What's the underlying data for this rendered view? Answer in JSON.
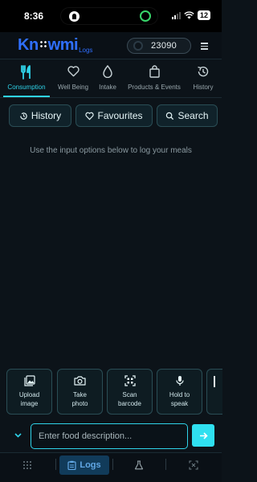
{
  "status_bar": {
    "time": "8:36",
    "battery": "12"
  },
  "header": {
    "logo_main_1": "Kn",
    "logo_main_2": "wmi",
    "logo_sub": "Logs",
    "points": "23090"
  },
  "categories": [
    {
      "label": "Consumption",
      "icon": "utensils-icon",
      "active": true
    },
    {
      "label": "Well Being",
      "icon": "heart-icon",
      "active": false
    },
    {
      "label": "Intake",
      "icon": "drop-icon",
      "active": false
    },
    {
      "label": "Products & Events",
      "icon": "shopping-bag-icon",
      "active": false
    },
    {
      "label": "History",
      "icon": "history-icon",
      "active": false
    }
  ],
  "actions": {
    "history": "History",
    "favourites": "Favourites",
    "search": "Search"
  },
  "empty_message": "Use the input options below to log your meals",
  "input_options": [
    {
      "line1": "Upload",
      "line2": "image",
      "icon": "image-icon"
    },
    {
      "line1": "Take",
      "line2": "photo",
      "icon": "camera-icon"
    },
    {
      "line1": "Scan",
      "line2": "barcode",
      "icon": "barcode-scan-icon"
    },
    {
      "line1": "Hold to",
      "line2": "speak",
      "icon": "microphone-icon"
    }
  ],
  "food_input": {
    "placeholder": "Enter food description...",
    "value": ""
  },
  "bottom_nav": {
    "logs_label": "Logs"
  },
  "colors": {
    "accent": "#2fd3e9",
    "brand": "#2f6fff",
    "background": "#0c1319"
  }
}
